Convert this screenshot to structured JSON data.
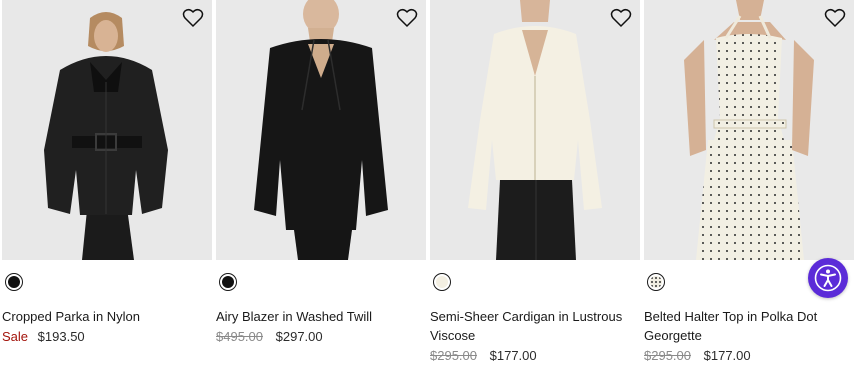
{
  "products": [
    {
      "name": "Cropped Parka in Nylon",
      "sale_label": "Sale",
      "price": "$193.50",
      "swatch": {
        "color": "#111111",
        "icon": "color-swatch-black"
      }
    },
    {
      "name": "Airy Blazer in Washed Twill",
      "original_price": "$495.00",
      "price": "$297.00",
      "swatch": {
        "color": "#111111",
        "icon": "color-swatch-black"
      }
    },
    {
      "name": "Semi-Sheer Cardigan in Lustrous Viscose",
      "original_price": "$295.00",
      "price": "$177.00",
      "swatch": {
        "color": "#f3efe2",
        "icon": "color-swatch-ivory"
      }
    },
    {
      "name": "Belted Halter Top in Polka Dot Georgette",
      "original_price": "$295.00",
      "price": "$177.00",
      "swatch": {
        "color": "#f1eee2",
        "icon": "color-swatch-polka-dot"
      }
    }
  ],
  "icons": {
    "wishlist": "heart-outline-icon",
    "accessibility": "accessibility-person-icon"
  },
  "colors": {
    "sale": "#a3130b",
    "strikethrough": "#8a8a8a",
    "accessibility_button": "#5b2bd8",
    "photo_background": "#e9e9e9"
  }
}
